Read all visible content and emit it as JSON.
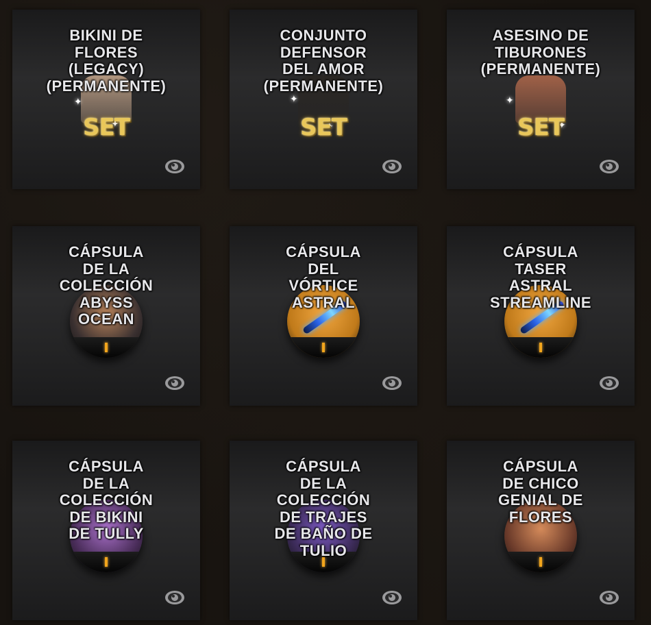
{
  "cards": [
    {
      "title": "BIKINI DE\nFLORES\n(LEGACY)\n(PERMANENTE)",
      "art": "set",
      "badge": "SET",
      "figures_color": "#c9a98e",
      "view_icon": "eye-icon"
    },
    {
      "title": "CONJUNTO\nDEFENSOR\nDEL AMOR\n(PERMANENTE)",
      "art": "set",
      "badge": "SET",
      "figures_color": "#2a2622",
      "view_icon": "eye-icon"
    },
    {
      "title": "ASESINO DE\nTIBURONES\n(PERMANENTE)",
      "art": "set",
      "badge": "SET",
      "figures_color": "#b46a4c",
      "view_icon": "eye-icon"
    },
    {
      "title": "CÁPSULA\nDE LA\nCOLECCIÓN\nABYSS\nOCEAN",
      "art": "capsule",
      "orb_bg": "#3a3030",
      "orb_glow": "#b8835a",
      "orb_item": "figures",
      "view_icon": "eye-icon"
    },
    {
      "title": "CÁPSULA\nDEL\nVÓRTICE\nASTRAL",
      "art": "capsule",
      "orb_bg": "#c07a1a",
      "orb_glow": "#f0a640",
      "orb_item": "weapon",
      "view_icon": "eye-icon"
    },
    {
      "title": "CÁPSULA\nTASER\nASTRAL\nSTREAMLINE",
      "art": "capsule",
      "orb_bg": "#c07a1a",
      "orb_glow": "#f0a640",
      "orb_item": "weapon",
      "view_icon": "eye-icon"
    },
    {
      "title": "CÁPSULA\nDE LA\nCOLECCIÓN\nDE BIKINI\nDE TULLY",
      "art": "capsule",
      "orb_bg": "#4a2d5a",
      "orb_glow": "#a870c8",
      "orb_item": "figures",
      "view_icon": "eye-icon"
    },
    {
      "title": "CÁPSULA\nDE LA\nCOLECCIÓN\nDE TRAJES\nDE BAÑO DE\nTULIO",
      "art": "capsule",
      "orb_bg": "#3a2a55",
      "orb_glow": "#7a58c0",
      "orb_item": "figures",
      "view_icon": "eye-icon"
    },
    {
      "title": "CÁPSULA\nDE CHICO\nGENIAL DE\nFLORES",
      "art": "capsule",
      "orb_bg": "#6a3a2a",
      "orb_glow": "#d48a5a",
      "orb_item": "figures",
      "view_icon": "eye-icon"
    }
  ],
  "colors": {
    "background": "#17130f",
    "card_text": "#e7e7ea",
    "set_gold": "#e9c75a",
    "eye_icon": "#9a9a9c"
  }
}
